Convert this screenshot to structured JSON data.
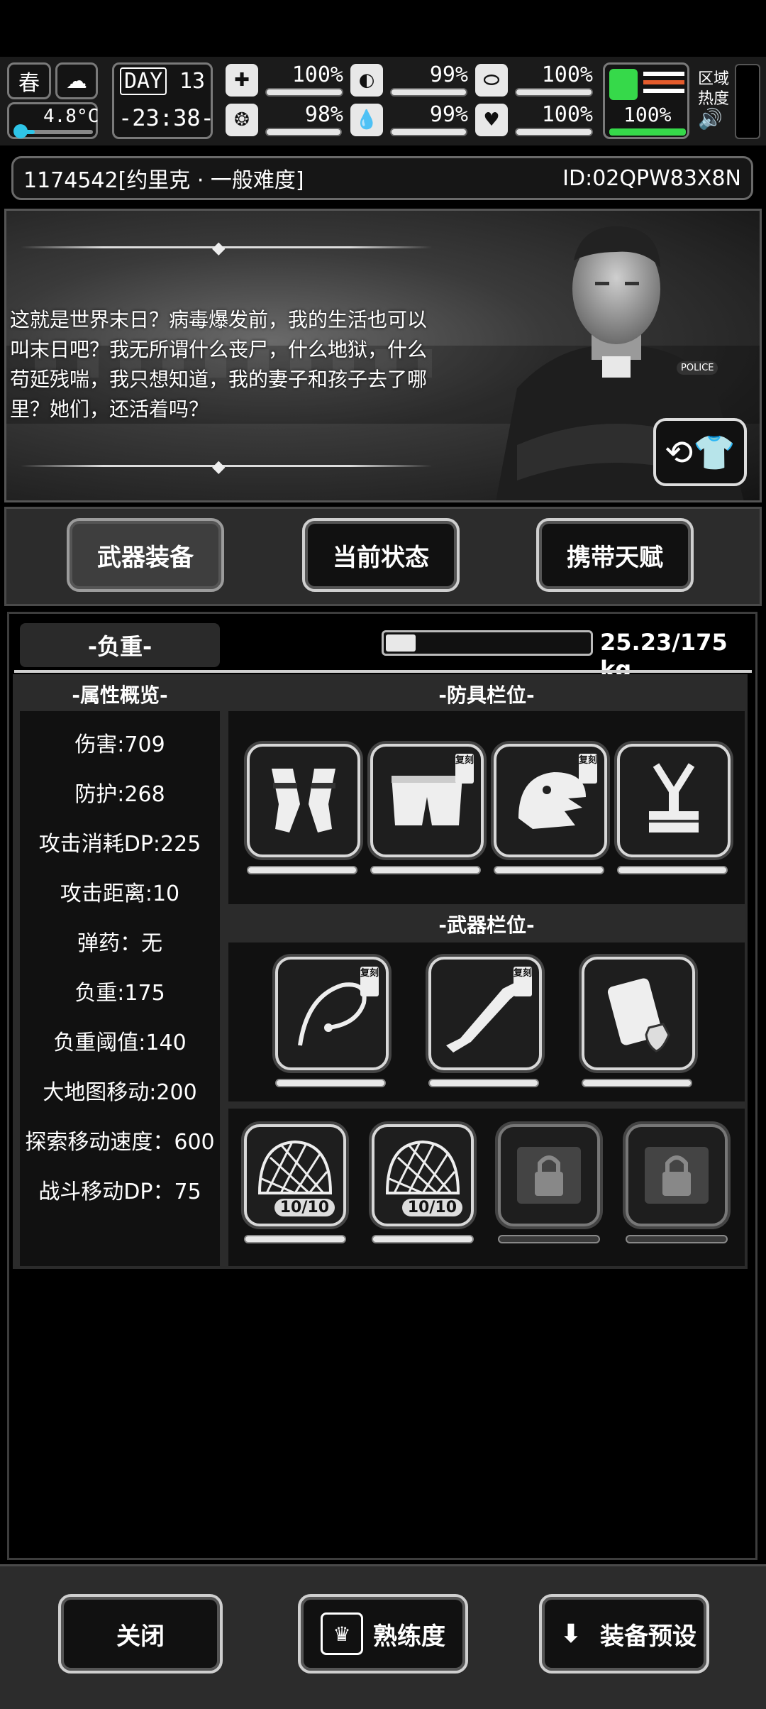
{
  "hud": {
    "season": "春",
    "day_label": "DAY",
    "day_number": "13",
    "temperature": "4.8°C",
    "time": "-23:38-",
    "area_heat_label1": "区域",
    "area_heat_label2": "热度",
    "stats": [
      {
        "icon": "medkit-icon",
        "glyph": "✚",
        "value": "100%",
        "fill": 1.0
      },
      {
        "icon": "stomach-icon",
        "glyph": "◐",
        "value": "99%",
        "fill": 0.99
      },
      {
        "icon": "pill-icon",
        "glyph": "⬭",
        "value": "100%",
        "fill": 1.0
      },
      {
        "icon": "brain-icon",
        "glyph": "❂",
        "value": "98%",
        "fill": 0.98
      },
      {
        "icon": "water-drop-icon",
        "glyph": "💧",
        "value": "99%",
        "fill": 0.99
      },
      {
        "icon": "heart-icon",
        "glyph": "♥",
        "value": "100%",
        "fill": 1.0
      }
    ],
    "stamina": {
      "value": "100%",
      "fill": 1.0
    }
  },
  "header": {
    "title": "1174542[约里克 · 一般难度]",
    "id_text": "ID:02QPW83X8N"
  },
  "story": {
    "text": "这就是世界末日？病毒爆发前，我的生活也可以叫末日吧？我无所谓什么丧尸，什么地狱，什么苟延残喘，我只想知道，我的妻子和孩子去了哪里？她们，还活着吗？",
    "badge_text": "POLICE"
  },
  "tabs": [
    "武器装备",
    "当前状态",
    "携带天赋"
  ],
  "weight": {
    "label": "-负重-",
    "value": "25.23/175 kg",
    "fraction": 0.144
  },
  "sections": {
    "attributes": "-属性概览-",
    "armor": "-防具栏位-",
    "weapons": "-武器栏位-"
  },
  "attributes": [
    "伤害:709",
    "防护:268",
    "攻击消耗DP:225",
    "攻击距离:10",
    "弹药：无",
    "负重:175",
    "负重阈值:140",
    "大地图移动:200",
    "探索移动速度：600",
    "战斗移动DP：75"
  ],
  "replica_badge": "复刻",
  "armor_slots": [
    {
      "icon": "gloves-icon",
      "replica": false
    },
    {
      "icon": "shorts-icon",
      "replica": true
    },
    {
      "icon": "dinosaur-mask-icon",
      "replica": true
    },
    {
      "icon": "harness-icon",
      "replica": false
    }
  ],
  "weapon_slots": [
    {
      "icon": "whip-icon",
      "replica": true
    },
    {
      "icon": "rifle-icon",
      "replica": true
    },
    {
      "icon": "shield-case-icon",
      "replica": false
    }
  ],
  "quick_slots": [
    {
      "icon": "net-icon",
      "count": "10/10",
      "locked": false
    },
    {
      "icon": "net-icon",
      "count": "10/10",
      "locked": false
    },
    {
      "icon": "lock-icon",
      "count": "",
      "locked": true
    },
    {
      "icon": "lock-icon",
      "count": "",
      "locked": true
    }
  ],
  "bottom": {
    "close": "关闭",
    "proficiency": "熟练度",
    "preset": "装备预设"
  }
}
